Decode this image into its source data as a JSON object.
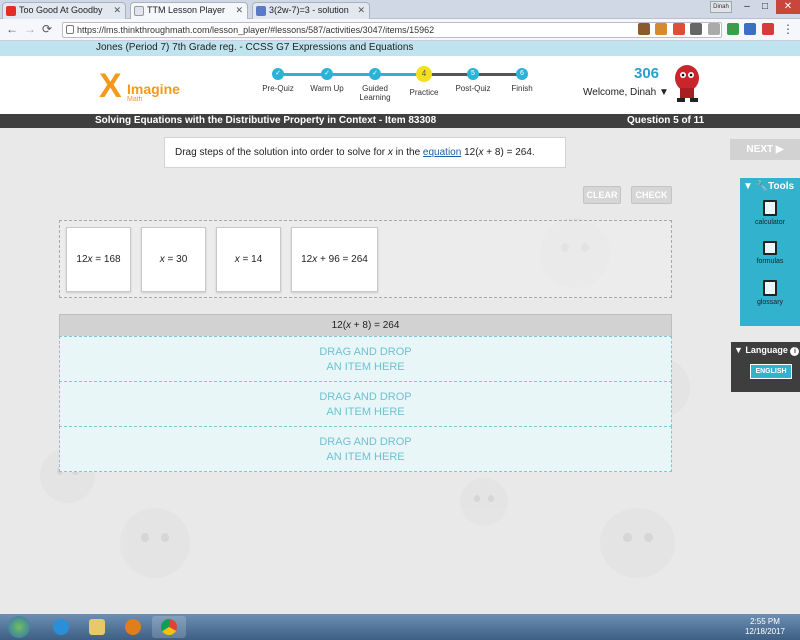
{
  "browser": {
    "tabs": [
      {
        "title": "Too Good At Goodby",
        "active": false,
        "icon": "youtube-icon",
        "color": "#e52d27"
      },
      {
        "title": "TTM Lesson Player",
        "active": true,
        "icon": "page-icon",
        "color": "#dfe5ee"
      },
      {
        "title": "3(2w-7)=3 - solution",
        "active": false,
        "icon": "brainly-icon",
        "color": "#5b79c4"
      }
    ],
    "user_badge": "Dinah",
    "url": "https://lms.thinkthroughmath.com/lesson_player/#lessons/587/activities/3047/items/15962"
  },
  "course_title": "Jones (Period 7) 7th Grade reg. - CCSS G7 Expressions and Equations",
  "header": {
    "logo_name": "Imagine",
    "logo_sub": "Math",
    "steps": [
      {
        "label": "Pre-Quiz",
        "status": "done",
        "mark": "✓"
      },
      {
        "label": "Warm Up",
        "status": "done",
        "mark": "✓"
      },
      {
        "label": "Guided Learning",
        "status": "done",
        "mark": "✓"
      },
      {
        "label": "Practice",
        "status": "current",
        "mark": "4"
      },
      {
        "label": "Post-Quiz",
        "status": "todo",
        "mark": "5"
      },
      {
        "label": "Finish",
        "status": "todo",
        "mark": "6"
      }
    ],
    "points": "306",
    "welcome": "Welcome, Dinah ▼"
  },
  "lesson": {
    "title": "Solving Equations with the Distributive Property in Context - Item 83308",
    "question_counter": "Question 5 of 11"
  },
  "question": {
    "prompt_before": "Drag steps of the solution into order to solve for ",
    "prompt_var": "x",
    "prompt_mid": " in the ",
    "prompt_link": "equation",
    "prompt_after_a": " 12(",
    "prompt_after_var": "x",
    "prompt_after_b": " + 8) = 264."
  },
  "buttons": {
    "clear": "CLEAR",
    "check": "CHECK",
    "next": "NEXT ▶"
  },
  "cards": [
    {
      "pre": "12",
      "var": "x",
      "post": " = 168"
    },
    {
      "pre": "",
      "var": "x",
      "post": " = 30"
    },
    {
      "pre": "",
      "var": "x",
      "post": " = 14"
    },
    {
      "pre": "12",
      "var": "x",
      "post": " + 96 = 264"
    }
  ],
  "target": {
    "header_pre": "12(",
    "header_var": "x",
    "header_post": " + 8) = 264",
    "slots": [
      {
        "line1": "DRAG AND DROP",
        "line2": "AN ITEM HERE"
      },
      {
        "line1": "DRAG AND DROP",
        "line2": "AN ITEM HERE"
      },
      {
        "line1": "DRAG AND DROP",
        "line2": "AN ITEM HERE"
      }
    ]
  },
  "tools": {
    "heading": "▼ 🔧Tools",
    "items": [
      {
        "label": "calculator",
        "icon": "calculator-icon"
      },
      {
        "label": "formulas",
        "icon": "formulas-icon"
      },
      {
        "label": "glossary",
        "icon": "glossary-icon"
      }
    ]
  },
  "language": {
    "heading": "▼ Language",
    "info": "i",
    "button": "ENGLISH"
  },
  "taskbar": {
    "time": "2:55 PM",
    "date": "12/18/2017"
  },
  "colors": {
    "accent": "#32b2cd",
    "logo": "#f39a1d",
    "current_step": "#f3e01c",
    "dark_bar": "#3f3f3f"
  }
}
